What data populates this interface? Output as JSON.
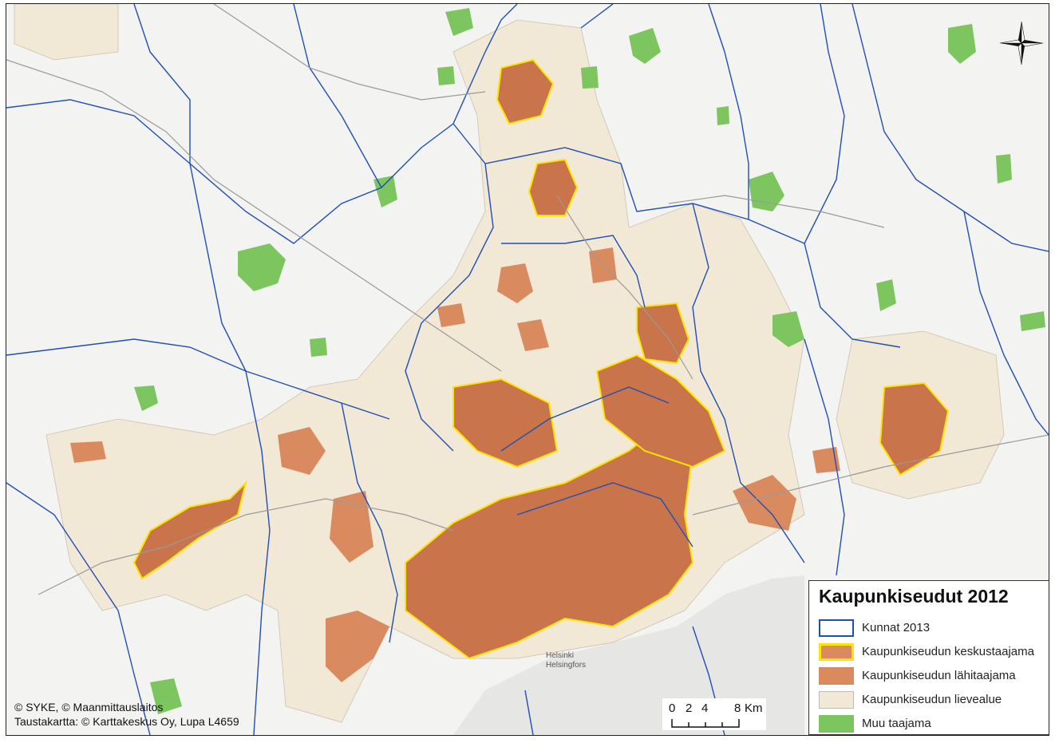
{
  "legend": {
    "title": "Kaupunkiseudut 2012",
    "items": [
      {
        "label": "Kunnat 2013",
        "fill": "#ffffff",
        "stroke": "#1f4fb5"
      },
      {
        "label": "Kaupunkiseudun keskustaajama",
        "fill": "#d98a5f",
        "stroke": "#ffe400"
      },
      {
        "label": "Kaupunkiseudun lähitaajama",
        "fill": "#d98a5f",
        "stroke": "#d98a5f"
      },
      {
        "label": "Kaupunkiseudun lievealue",
        "fill": "#f1e8d6",
        "stroke": "#bbbbbb"
      },
      {
        "label": "Muu taajama",
        "fill": "#7dc55f",
        "stroke": "#7dc55f"
      }
    ]
  },
  "copyright": {
    "line1": "© SYKE, © Maanmittauslaitos",
    "line2": "Taustakartta: © Karttakeskus Oy, Lupa L4659"
  },
  "scale": {
    "ticks": [
      "0",
      "2",
      "4",
      "8"
    ],
    "unit": "Km"
  },
  "colors": {
    "municipality_border": "#1f4fb5",
    "core_urban": "#c9744a",
    "core_outline": "#ffe400",
    "nearby_urban": "#d98a5f",
    "fringe": "#f1e8d6",
    "other_urban": "#7dc55f",
    "sea": "#e8e8e6",
    "background": "#f3f3f1"
  },
  "place_labels": [
    "Helsinki",
    "Helsingfors"
  ]
}
